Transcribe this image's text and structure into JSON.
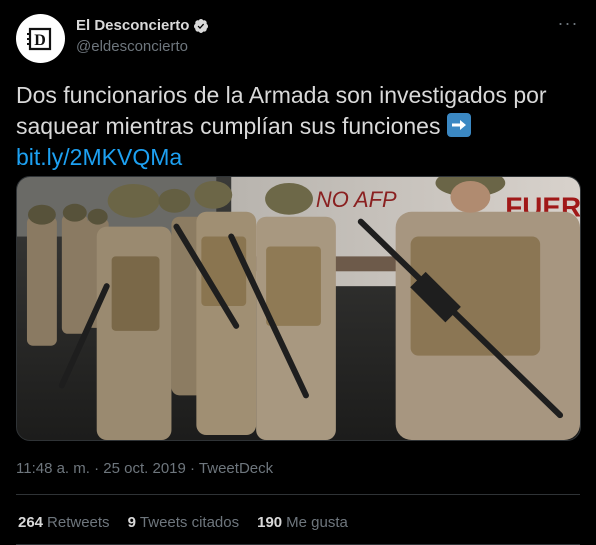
{
  "author": {
    "display_name": "El Desconcierto",
    "handle": "@eldesconcierto",
    "avatar_letter": "D"
  },
  "tweet": {
    "text": "Dos funcionarios de la Armada son investigados por saquear mientras cumplían sus funciones",
    "emoji": "arrow-right-icon",
    "link": "bit.ly/2MKVQMa",
    "media_signs": [
      "NO AFP",
      "FUERZ"
    ]
  },
  "meta": {
    "time": "11:48 a. m.",
    "separator1": " · ",
    "date": "25 oct. 2019",
    "separator2": " · ",
    "source": "TweetDeck"
  },
  "stats": [
    {
      "count": "264",
      "label": "Retweets"
    },
    {
      "count": "9",
      "label": "Tweets citados"
    },
    {
      "count": "190",
      "label": "Me gusta"
    }
  ],
  "colors": {
    "background": "#000000",
    "text": "#d9d9d9",
    "muted": "#6e767d",
    "link": "#1da1f2",
    "verified": "#d9d9d9"
  }
}
